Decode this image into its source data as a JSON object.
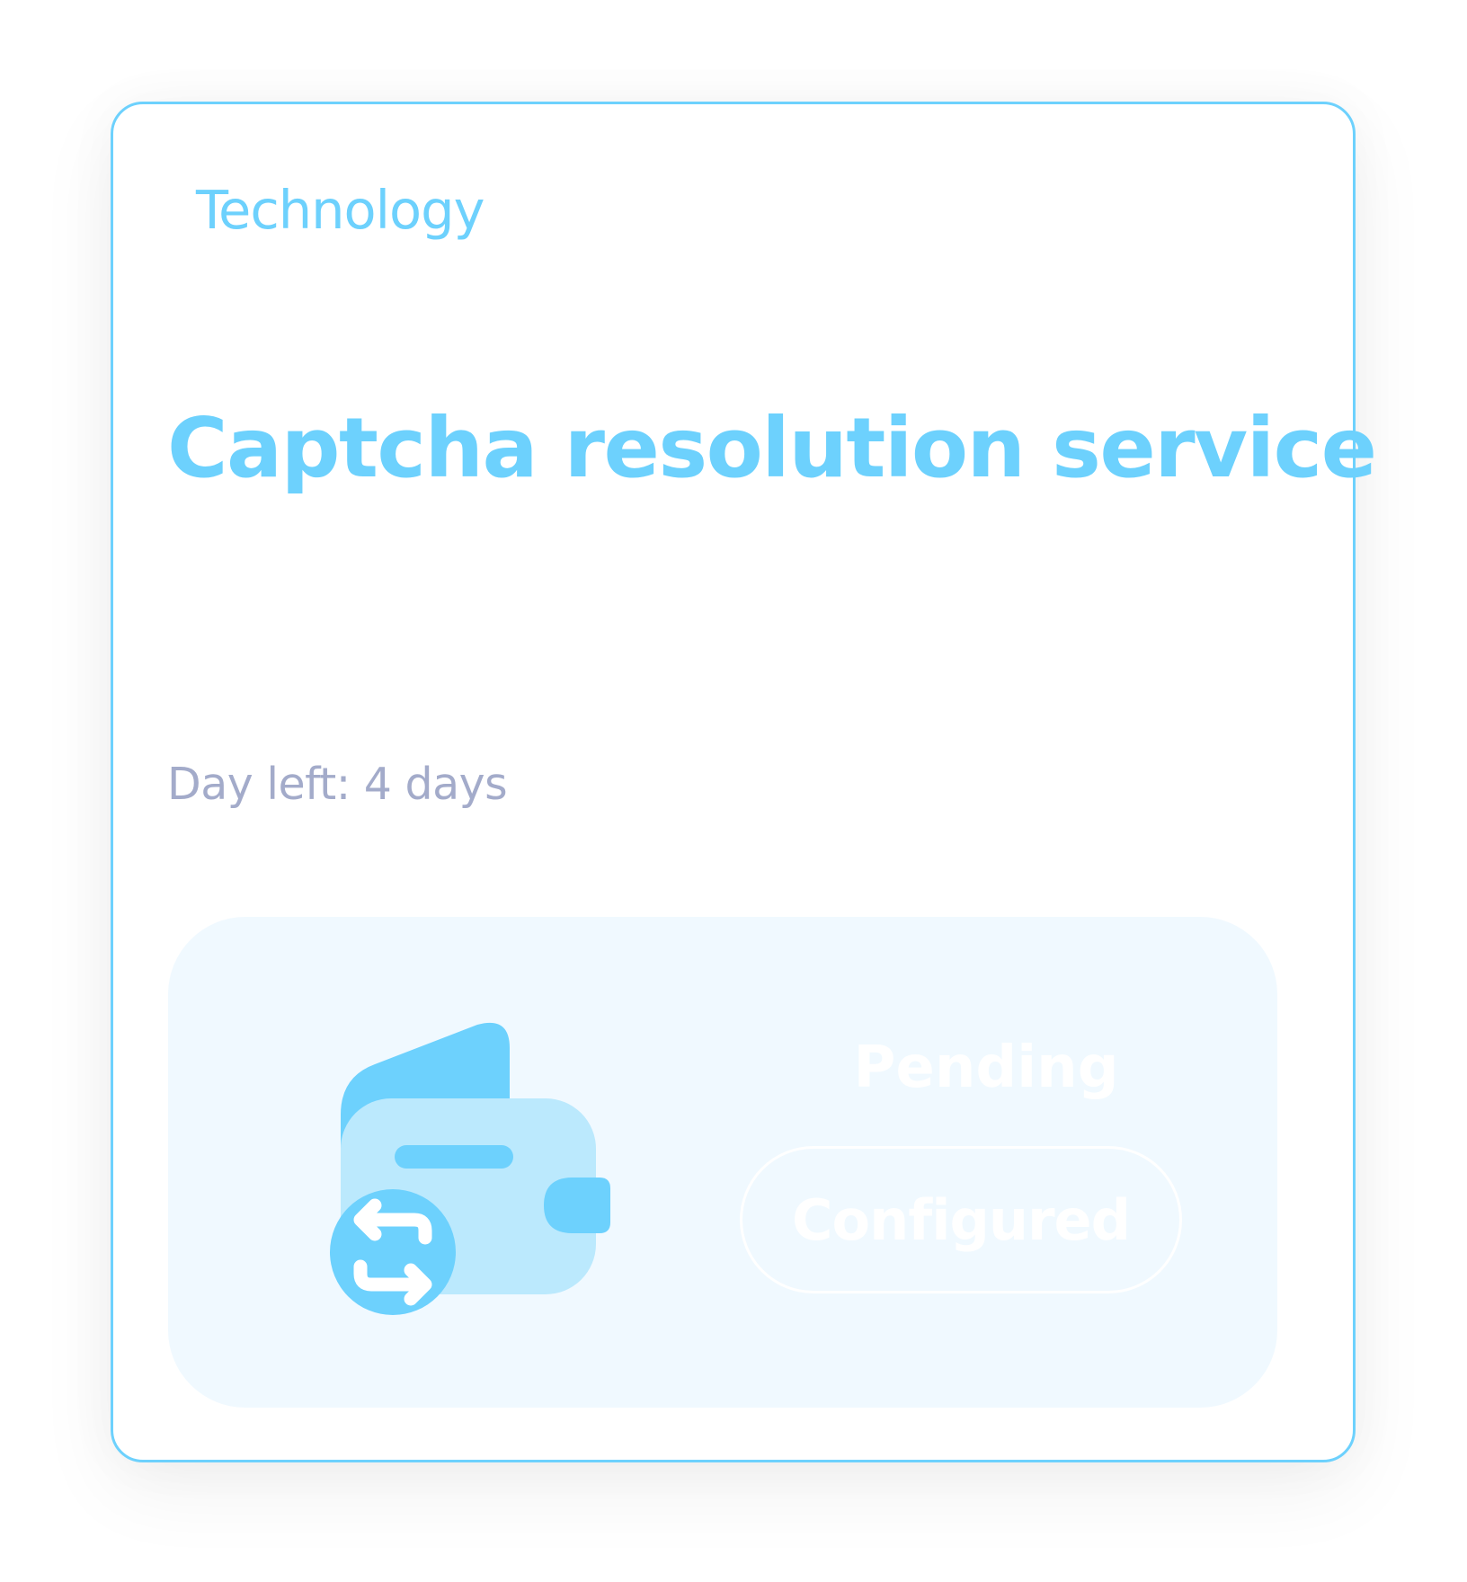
{
  "card": {
    "category": "Technology",
    "title": "Captcha resolution service",
    "days_left": "Day left: 4 days"
  },
  "panel": {
    "illustration_icon": "wallet-transfer-icon",
    "status_text": "Pending",
    "status_button_label": "Configured"
  },
  "colors": {
    "accent": "#6dd1fd",
    "accent_light": "#bbe9fd",
    "muted_text": "#a3abca",
    "panel_background": "#f0f9ff",
    "border": "#6dd1fd"
  }
}
